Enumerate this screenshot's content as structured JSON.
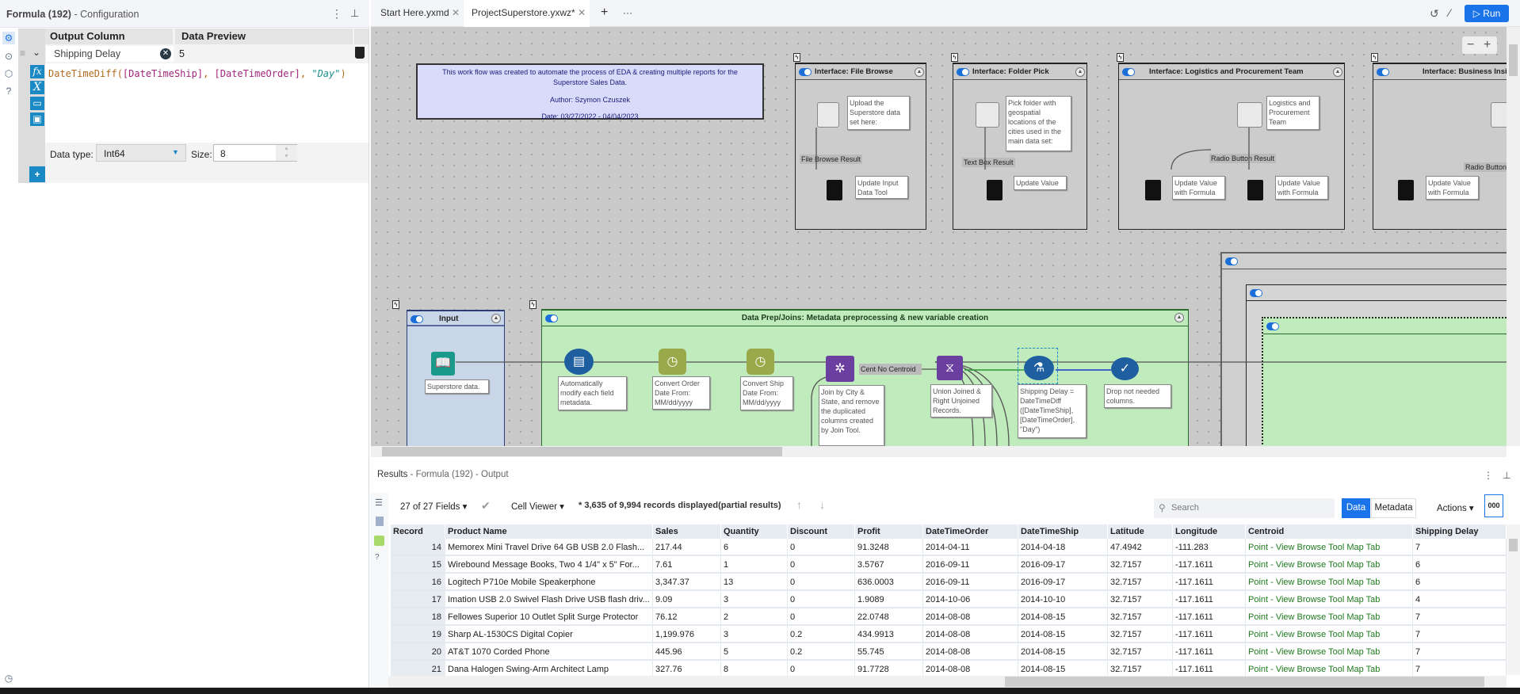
{
  "config": {
    "title": "Formula (192)",
    "subtitle": "- Configuration",
    "col_output": "Output Column",
    "col_preview": "Data Preview",
    "output_value": "Shipping Delay",
    "preview_value": "5",
    "formula": {
      "fn": "DateTimeDiff(",
      "f1": "[DateTimeShip]",
      "sep": ", ",
      "f2": "[DateTimeOrder]",
      "s": "\"Day\"",
      "end": ")"
    },
    "datatype_label": "Data type:",
    "datatype_value": "Int64",
    "size_label": "Size:",
    "size_value": "8",
    "fx_buttons": [
      "fx",
      "X",
      "open",
      "save"
    ],
    "add_label": "+"
  },
  "tabs": [
    {
      "label": "Start Here.yxmd"
    },
    {
      "label": "ProjectSuperstore.yxwz*"
    }
  ],
  "toolbar": {
    "run_label": "Run",
    "add_tab": "+",
    "more_tabs": "···",
    "zoom_out": "−",
    "zoom_in": "+"
  },
  "canvas": {
    "comment": [
      "This work flow was created to automate the process of EDA & creating multiple reports for the Superstore Sales Data.",
      "Author: Szymon Czuszek",
      "Date: 03/27/2022 - 04/04/2023"
    ],
    "interfaces": [
      {
        "title": "Interface: File Browse",
        "annotation": "Upload the Superstore data set here:",
        "result": "File Browse Result",
        "actions": [
          "Update Input Data Tool"
        ]
      },
      {
        "title": "Interface: Folder Pick",
        "annotation": "Pick folder with geospatial locations of the cities used in the main data set:",
        "result": "Text Box Result",
        "actions": [
          "Update Value"
        ]
      },
      {
        "title": "Interface: Logistics and Procurement Team",
        "annotation": "Logistics and Procurement Team",
        "result": "Radio Button Result",
        "actions": [
          "Update Value with Formula",
          "Update Value with Formula"
        ]
      },
      {
        "title": "Interface: Business Insig",
        "result": "Radio Button",
        "actions": [
          "Update Value with Formula"
        ]
      }
    ],
    "input_box": {
      "title": "Input",
      "annotation": "Superstore data."
    },
    "prep_box": {
      "title": "Data Prep/Joins: Metadata preprocessing & new variable creation",
      "tools": [
        {
          "annotation": "Automatically modify each field metadata.",
          "color": "#1f5fa0"
        },
        {
          "annotation": "Convert Order Date From: MM/dd/yyyy",
          "color": "#9aa94a"
        },
        {
          "annotation": "Convert Ship Date From: MM/dd/yyyy",
          "color": "#9aa94a"
        },
        {
          "annotation": "Join by City & State, and remove the duplicated columns created by Join Tool.",
          "color": "#6b3fa0"
        },
        {
          "annotation": "Union Joined & Right Unjoined Records.",
          "color": "#6b3fa0"
        },
        {
          "annotation": "Shipping Delay = DateTimeDiff ([DateTimeShip], [DateTimeOrder], \"Day\")",
          "color": "#1f5fa0"
        },
        {
          "annotation": "Drop not needed columns.",
          "color": "#1f5fa0"
        }
      ],
      "join_label": "Cent No Centroid"
    }
  },
  "results": {
    "title": "Results",
    "subtitle": "- Formula (192) - Output",
    "fields": "27 of 27 Fields",
    "cell_viewer": "Cell Viewer",
    "status": "* 3,635 of 9,994 records displayed(partial results)",
    "search_placeholder": "Search",
    "data_tab": "Data",
    "metadata_tab": "Metadata",
    "actions": "Actions",
    "format_btn": "000",
    "columns": [
      "Record",
      "Product Name",
      "Sales",
      "Quantity",
      "Discount",
      "Profit",
      "DateTimeOrder",
      "DateTimeShip",
      "Latitude",
      "Longitude",
      "Centroid",
      "Shipping Delay"
    ],
    "rows": [
      [
        "14",
        "Memorex Mini Travel Drive 64 GB USB 2.0 Flash...",
        "217.44",
        "6",
        "0",
        "91.3248",
        "2014-04-11",
        "2014-04-18",
        "47.4942",
        "-111.283",
        "Point - View Browse Tool Map Tab",
        "7"
      ],
      [
        "15",
        "Wirebound Message Books, Two 4 1/4\" x 5\" For...",
        "7.61",
        "1",
        "0",
        "3.5767",
        "2016-09-11",
        "2016-09-17",
        "32.7157",
        "-117.1611",
        "Point - View Browse Tool Map Tab",
        "6"
      ],
      [
        "16",
        "Logitech P710e Mobile Speakerphone",
        "3,347.37",
        "13",
        "0",
        "636.0003",
        "2016-09-11",
        "2016-09-17",
        "32.7157",
        "-117.1611",
        "Point - View Browse Tool Map Tab",
        "6"
      ],
      [
        "17",
        "Imation USB 2.0 Swivel Flash Drive USB flash driv...",
        "9.09",
        "3",
        "0",
        "1.9089",
        "2014-10-06",
        "2014-10-10",
        "32.7157",
        "-117.1611",
        "Point - View Browse Tool Map Tab",
        "4"
      ],
      [
        "18",
        "Fellowes Superior 10 Outlet Split Surge Protector",
        "76.12",
        "2",
        "0",
        "22.0748",
        "2014-08-08",
        "2014-08-15",
        "32.7157",
        "-117.1611",
        "Point - View Browse Tool Map Tab",
        "7"
      ],
      [
        "19",
        "Sharp AL-1530CS Digital Copier",
        "1,199.976",
        "3",
        "0.2",
        "434.9913",
        "2014-08-08",
        "2014-08-15",
        "32.7157",
        "-117.1611",
        "Point - View Browse Tool Map Tab",
        "7"
      ],
      [
        "20",
        "AT&T 1070 Corded Phone",
        "445.96",
        "5",
        "0.2",
        "55.745",
        "2014-08-08",
        "2014-08-15",
        "32.7157",
        "-117.1611",
        "Point - View Browse Tool Map Tab",
        "7"
      ],
      [
        "21",
        "Dana Halogen Swing-Arm Architect Lamp",
        "327.76",
        "8",
        "0",
        "91.7728",
        "2014-08-08",
        "2014-08-15",
        "32.7157",
        "-117.1611",
        "Point - View Browse Tool Map Tab",
        "7"
      ]
    ]
  },
  "colors": {
    "accent": "#1a73e8",
    "tool_blue": "#1b8ac4",
    "container_green": "#c0ebbd",
    "input_box": "#c9d6e8",
    "comment_bg": "#d8dcfa"
  }
}
